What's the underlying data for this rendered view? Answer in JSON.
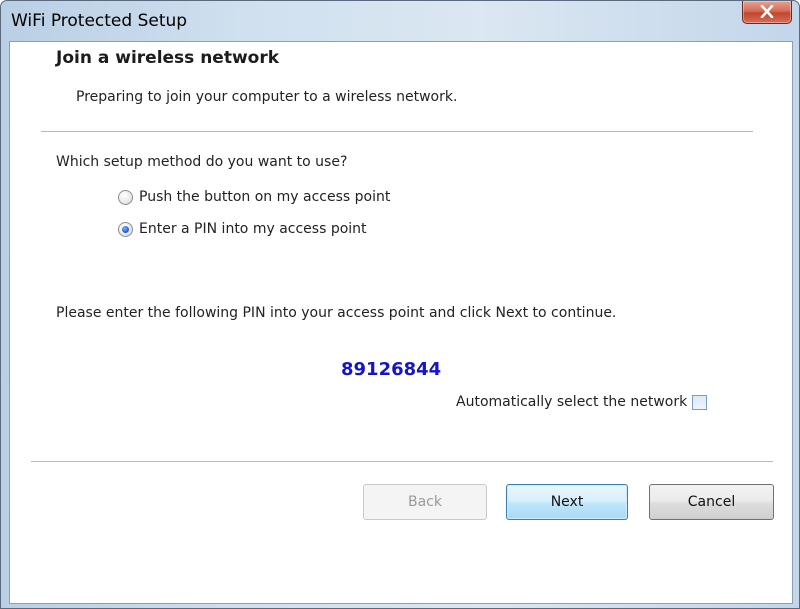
{
  "window": {
    "title": "WiFi Protected Setup",
    "close_icon": "close-icon"
  },
  "content": {
    "heading": "Join a wireless network",
    "subheading": "Preparing to join your computer to a wireless network.",
    "question": "Which setup method do you want to use?",
    "options": [
      {
        "label": "Push the button on my access point",
        "selected": false
      },
      {
        "label": "Enter a PIN into my access point",
        "selected": true
      }
    ],
    "instruction": "Please enter the following PIN into your access point and click Next to continue.",
    "pin": "89126844",
    "auto_select_label": "Automatically select the network",
    "auto_select_checked": false
  },
  "buttons": {
    "back": "Back",
    "next": "Next",
    "cancel": "Cancel"
  },
  "colors": {
    "pin": "#1515c8",
    "close_button": "#c2462c"
  }
}
